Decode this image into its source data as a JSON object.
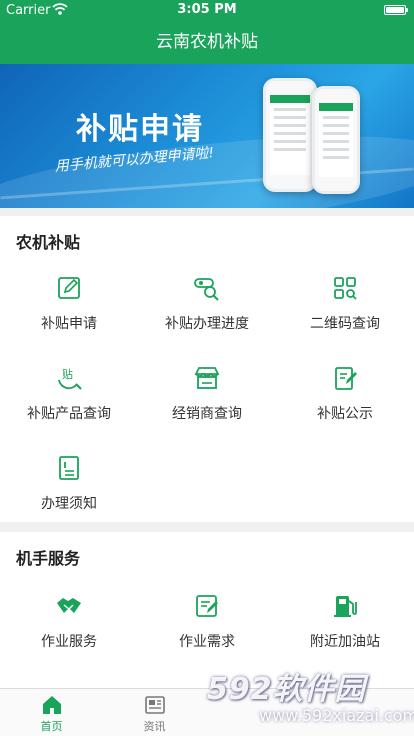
{
  "status_bar": {
    "carrier": "Carrier",
    "time": "3:05 PM",
    "battery_level": 1.0
  },
  "nav": {
    "title": "云南农机补贴"
  },
  "banner": {
    "title": "补贴申请",
    "slogan": "用手机就可以办理申请啦!"
  },
  "sections": [
    {
      "title": "农机补贴",
      "items": [
        {
          "label": "补贴申请",
          "icon": "edit-icon"
        },
        {
          "label": "补贴办理进度",
          "icon": "search-progress-icon"
        },
        {
          "label": "二维码查询",
          "icon": "qrcode-icon"
        },
        {
          "label": "补贴产品查询",
          "icon": "subsidy-search-icon"
        },
        {
          "label": "经销商查询",
          "icon": "store-icon"
        },
        {
          "label": "补贴公示",
          "icon": "notice-edit-icon"
        },
        {
          "label": "办理须知",
          "icon": "document-icon"
        }
      ]
    },
    {
      "title": "机手服务",
      "items": [
        {
          "label": "作业服务",
          "icon": "handshake-icon"
        },
        {
          "label": "作业需求",
          "icon": "form-edit-icon"
        },
        {
          "label": "附近加油站",
          "icon": "gas-station-icon"
        }
      ]
    }
  ],
  "tabbar": {
    "items": [
      {
        "label": "首页",
        "icon": "home-icon",
        "active": true
      },
      {
        "label": "资讯",
        "icon": "news-icon",
        "active": false
      }
    ]
  },
  "watermark": {
    "brand": "592软件园",
    "url": "www.592xiazai.com"
  },
  "colors": {
    "brand_green": "#1aa35a",
    "banner_blue": "#1d8fd8",
    "text": "#333333"
  }
}
